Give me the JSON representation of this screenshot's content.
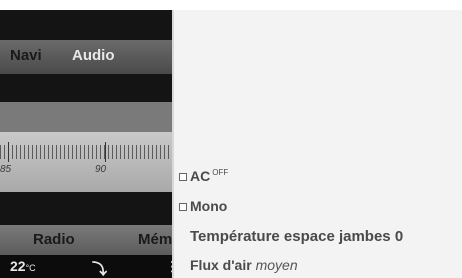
{
  "nav": {
    "items": [
      "Navi",
      "Audio"
    ],
    "active": "Audio"
  },
  "tuner": {
    "scale_labels": [
      "85",
      "90"
    ]
  },
  "bottom_menu": {
    "items": [
      "Radio",
      "Mém"
    ]
  },
  "status": {
    "temperature": "22",
    "temperature_unit": "°C",
    "fan_icon": "airflow-icon"
  },
  "menu": {
    "ac": {
      "label": "AC",
      "state": "OFF"
    },
    "mono": {
      "label": "Mono"
    },
    "footwell": {
      "label": "Température espace jambes",
      "value": "0"
    },
    "airflow": {
      "label": "Flux d'air",
      "value": "moyen"
    }
  }
}
